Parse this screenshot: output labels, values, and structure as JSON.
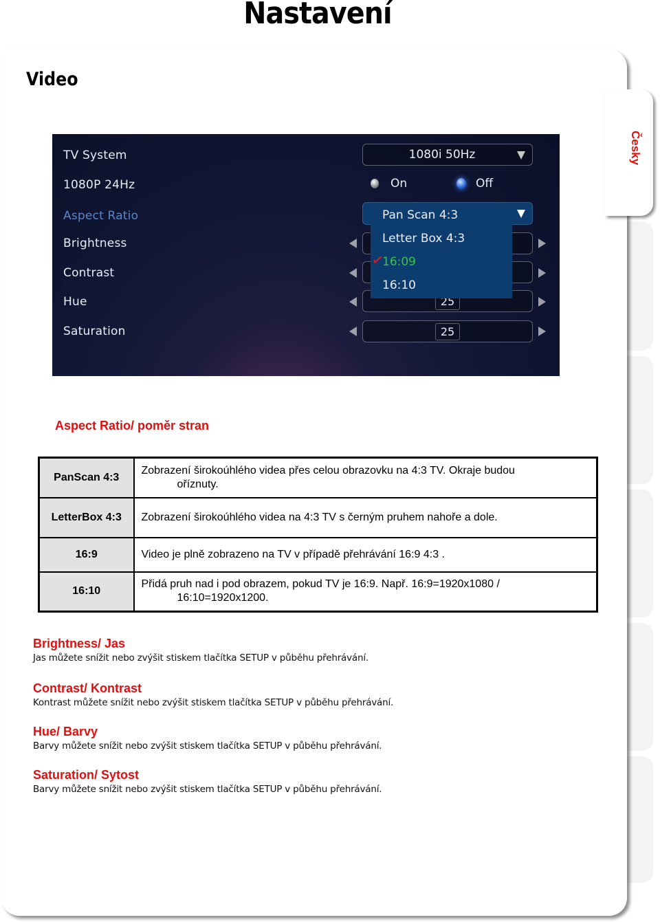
{
  "page": {
    "title": "Nastavení",
    "section_title": "Video",
    "language_tab": "Česky",
    "accent_color": "#e01010"
  },
  "tv_menu": {
    "rows": [
      {
        "label": "TV System",
        "control": "select",
        "value": "1080i 50Hz"
      },
      {
        "label": "1080P 24Hz",
        "control": "radio",
        "options": [
          "On",
          "Off"
        ],
        "selected": "Off"
      },
      {
        "label": "Aspect Ratio",
        "control": "select-open",
        "value": "Pan Scan 4:3",
        "active": true
      },
      {
        "label": "Brightness",
        "control": "stepper",
        "value": ""
      },
      {
        "label": "Contrast",
        "control": "stepper",
        "value": ""
      },
      {
        "label": "Hue",
        "control": "stepper",
        "value": "25"
      },
      {
        "label": "Saturation",
        "control": "stepper",
        "value": "25"
      }
    ],
    "aspect_dropdown": {
      "options": [
        "Pan Scan 4:3",
        "Letter Box 4:3",
        "16:09",
        "16:10"
      ],
      "checked": "16:09"
    }
  },
  "aspect_section": {
    "heading": "Aspect Ratio/ poměr stran",
    "rows": [
      {
        "key": "PanScan 4:3",
        "line1": "Zobrazení širokoúhlého videa přes celou  obrazovku na 4:3 TV. Okraje budou",
        "line2": "oříznuty."
      },
      {
        "key": "LetterBox 4:3",
        "line1": "Zobrazení širokoúhlého videa na 4:3 TV  s černým pruhem nahoře a dole.",
        "line2": ""
      },
      {
        "key": "16:9",
        "line1": "Video je plně zobrazeno na TV v případě  přehrávání 16:9   4:3 .",
        "line2": ""
      },
      {
        "key": "16:10",
        "line1": "Přidá pruh nad i pod obrazem, pokud TV je 16:9. Např. 16:9=1920x1080 /",
        "line2": "16:10=1920x1200."
      }
    ]
  },
  "sections": [
    {
      "heading": "Brightness/ Jas",
      "text": "Jas můžete snížit nebo zvýšit stiskem tlačítka SETUP v půběhu přehrávání."
    },
    {
      "heading": "Contrast/ Kontrast",
      "text": "Kontrast můžete snížit nebo zvýšit stiskem tlačítka SETUP v půběhu přehrávání."
    },
    {
      "heading": "Hue/ Barvy",
      "text": "Barvy  můžete snížit nebo zvýšit stiskem tlačítka SETUP v půběhu přehrávání."
    },
    {
      "heading": "Saturation/ Sytost",
      "text": "Barvy  můžete snížit nebo zvýšit stiskem tlačítka SETUP v půběhu přehrávání."
    }
  ]
}
